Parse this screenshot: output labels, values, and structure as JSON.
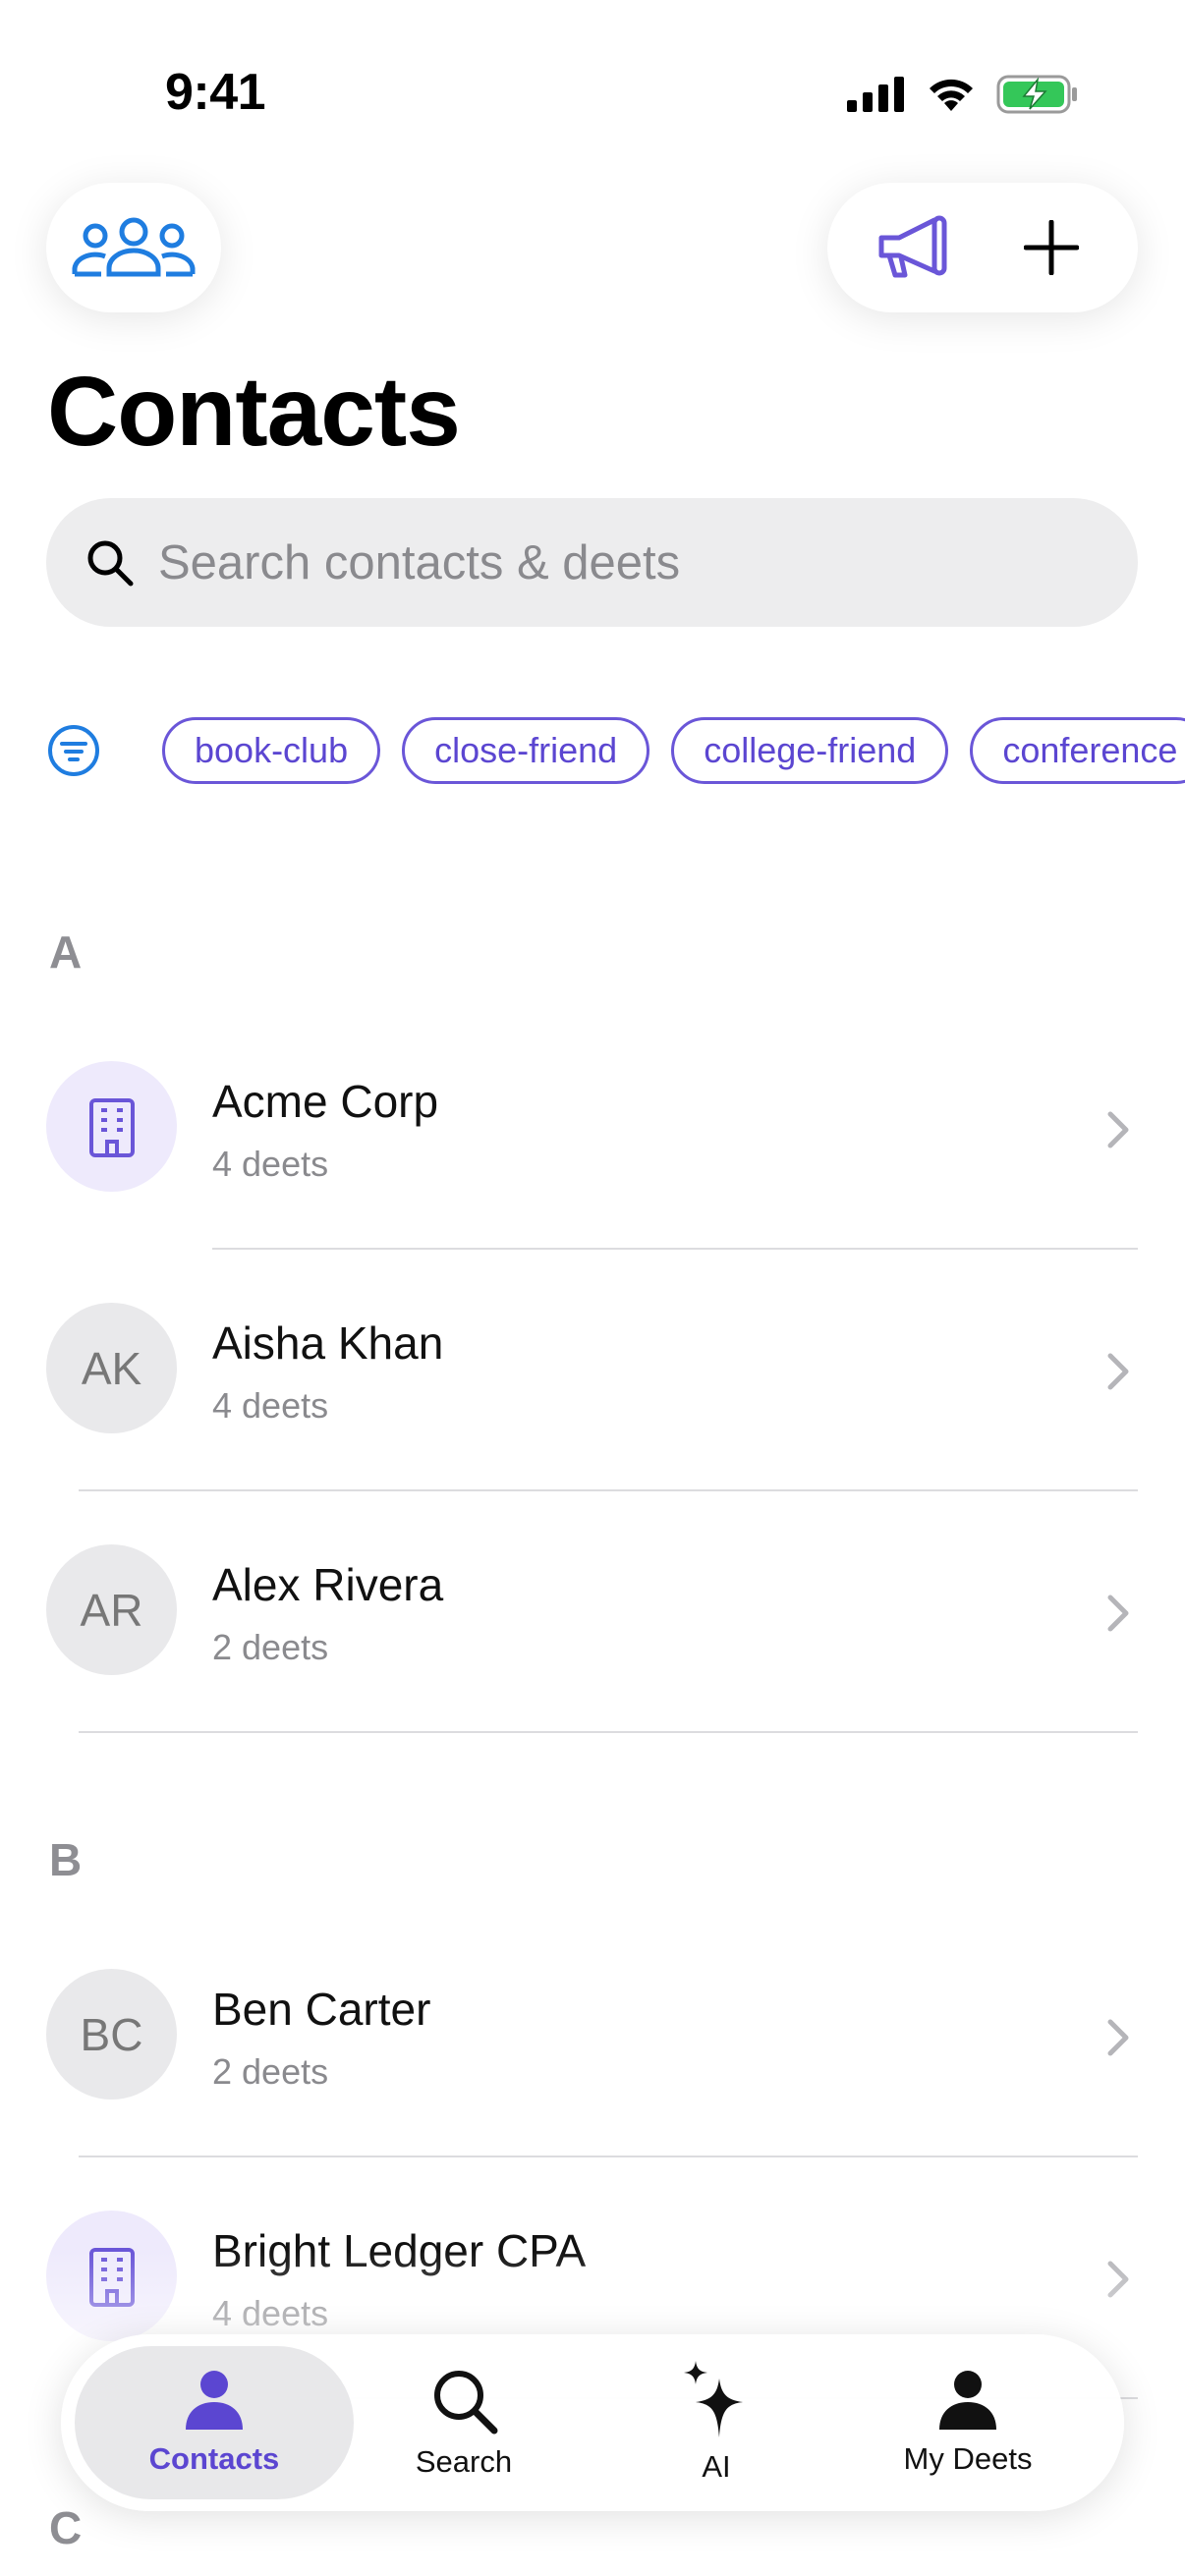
{
  "status_bar": {
    "time": "9:41"
  },
  "header": {
    "title": "Contacts"
  },
  "search": {
    "placeholder": "Search contacts & deets"
  },
  "filters": {
    "chips": [
      "book-club",
      "close-friend",
      "college-friend",
      "conference"
    ]
  },
  "sections": [
    {
      "letter": "A",
      "contacts": [
        {
          "name": "Acme Corp",
          "sub": "4 deets",
          "initials": "",
          "type": "org"
        },
        {
          "name": "Aisha Khan",
          "sub": "4 deets",
          "initials": "AK",
          "type": "person"
        },
        {
          "name": "Alex Rivera",
          "sub": "2 deets",
          "initials": "AR",
          "type": "person"
        }
      ]
    },
    {
      "letter": "B",
      "contacts": [
        {
          "name": "Ben Carter",
          "sub": "2 deets",
          "initials": "BC",
          "type": "person"
        },
        {
          "name": "Bright Ledger CPA",
          "sub": "4 deets",
          "initials": "",
          "type": "org"
        }
      ]
    },
    {
      "letter": "C",
      "contacts": []
    }
  ],
  "tabbar": {
    "tabs": [
      {
        "label": "Contacts",
        "icon": "person-fill-icon",
        "active": true
      },
      {
        "label": "Search",
        "icon": "magnifier-icon",
        "active": false
      },
      {
        "label": "AI",
        "icon": "sparkles-icon",
        "active": false
      },
      {
        "label": "My Deets",
        "icon": "person-icon",
        "active": false
      }
    ]
  },
  "colors": {
    "accent": "#5b46d1",
    "groups_blue": "#1f7de0",
    "battery_green": "#34c759"
  }
}
